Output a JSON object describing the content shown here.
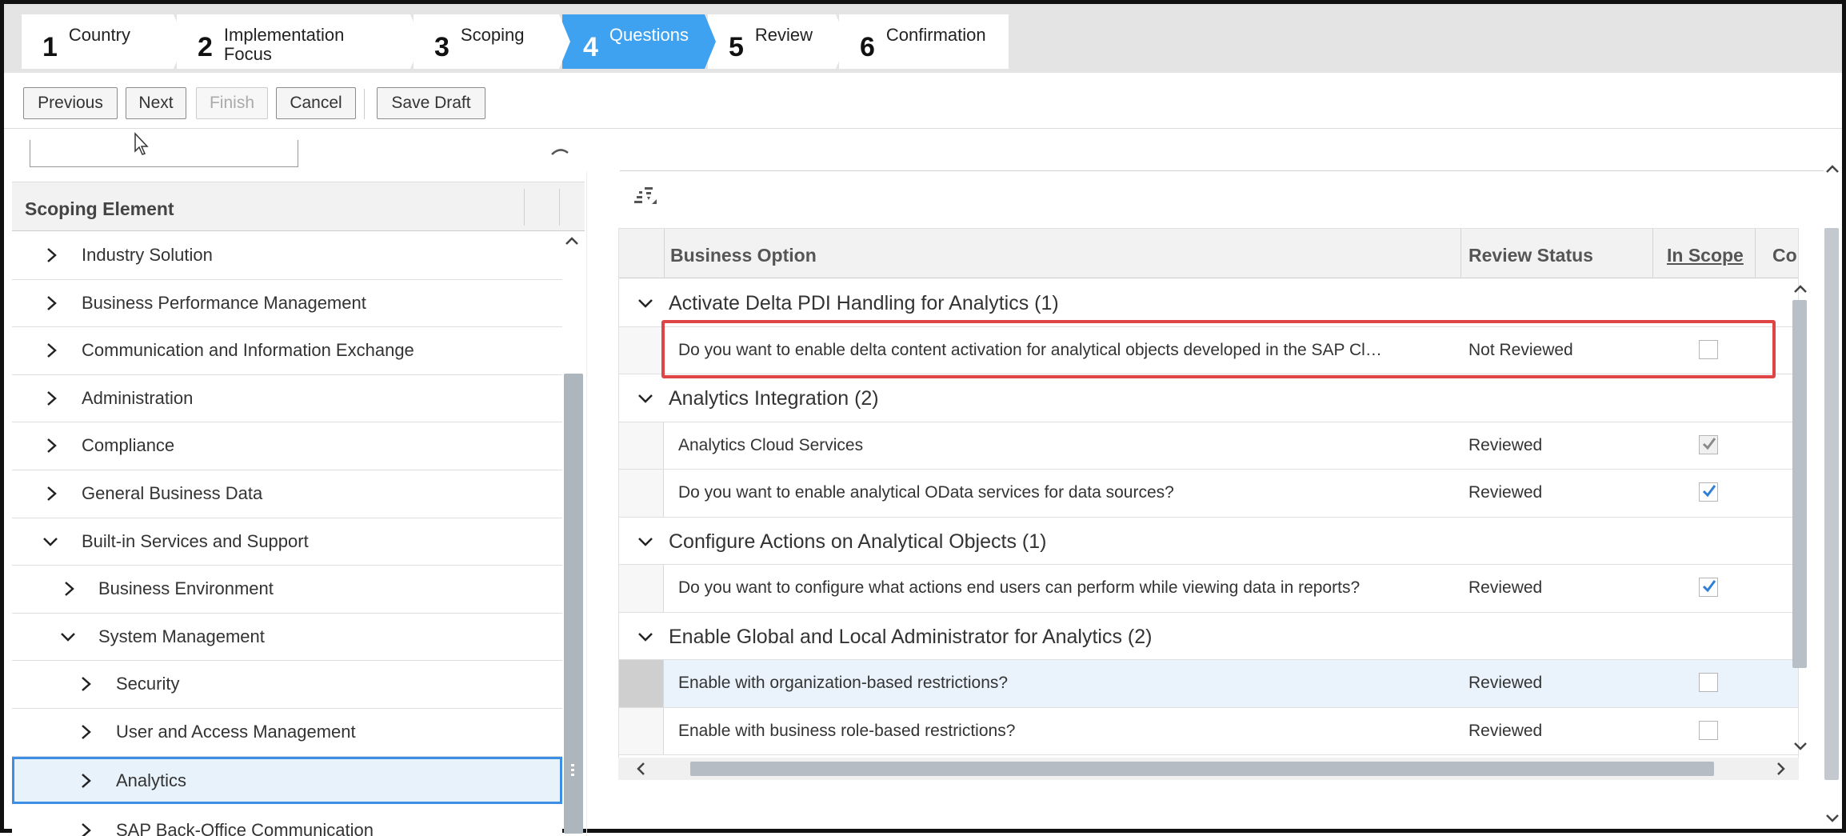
{
  "wizard": {
    "steps": [
      {
        "num": "1",
        "label": "Country"
      },
      {
        "num": "2",
        "label": "Implementation Focus"
      },
      {
        "num": "3",
        "label": "Scoping"
      },
      {
        "num": "4",
        "label": "Questions"
      },
      {
        "num": "5",
        "label": "Review"
      },
      {
        "num": "6",
        "label": "Confirmation"
      }
    ],
    "active_step": "4"
  },
  "toolbar": {
    "previous": "Previous",
    "next": "Next",
    "finish": "Finish",
    "cancel": "Cancel",
    "save_draft": "Save Draft"
  },
  "tree": {
    "header": "Scoping Element",
    "items": [
      {
        "label": "Industry Solution"
      },
      {
        "label": "Business Performance Management"
      },
      {
        "label": "Communication and Information Exchange"
      },
      {
        "label": "Administration"
      },
      {
        "label": "Compliance"
      },
      {
        "label": "General Business Data"
      },
      {
        "label": "Built-in Services and Support"
      },
      {
        "label": "Business Environment"
      },
      {
        "label": "System Management"
      },
      {
        "label": "Security"
      },
      {
        "label": "User and Access Management"
      },
      {
        "label": "Analytics"
      },
      {
        "label": "SAP Back-Office Communication"
      }
    ]
  },
  "table": {
    "columns": {
      "business_option": "Business Option",
      "review_status": "Review Status",
      "in_scope": "In Scope",
      "co": "Co"
    },
    "groups": [
      {
        "title": "Activate Delta PDI Handling for Analytics (1)",
        "rows": [
          {
            "question": "Do you want to enable delta content activation for analytical objects developed in the SAP Cloud Applications Studio?",
            "status": "Not Reviewed",
            "in_scope": false
          }
        ]
      },
      {
        "title": "Analytics Integration (2)",
        "rows": [
          {
            "question": "Analytics Cloud Services",
            "status": "Reviewed",
            "in_scope": true
          },
          {
            "question": "Do you want to enable analytical OData services for data sources?",
            "status": "Reviewed",
            "in_scope": true
          }
        ]
      },
      {
        "title": "Configure Actions on Analytical Objects (1)",
        "rows": [
          {
            "question": "Do you want to configure what actions end users can perform while viewing data in reports?",
            "status": "Reviewed",
            "in_scope": true
          }
        ]
      },
      {
        "title": "Enable Global and Local Administrator for Analytics (2)",
        "rows": [
          {
            "question": "Enable with organization-based restrictions?",
            "status": "Reviewed",
            "in_scope": false
          },
          {
            "question": "Enable with business role-based restrictions?",
            "status": "Reviewed",
            "in_scope": false
          }
        ]
      }
    ]
  },
  "colors": {
    "active_step": "#3ea2f0",
    "highlight": "#e04545",
    "check": "#2f7fd6"
  }
}
